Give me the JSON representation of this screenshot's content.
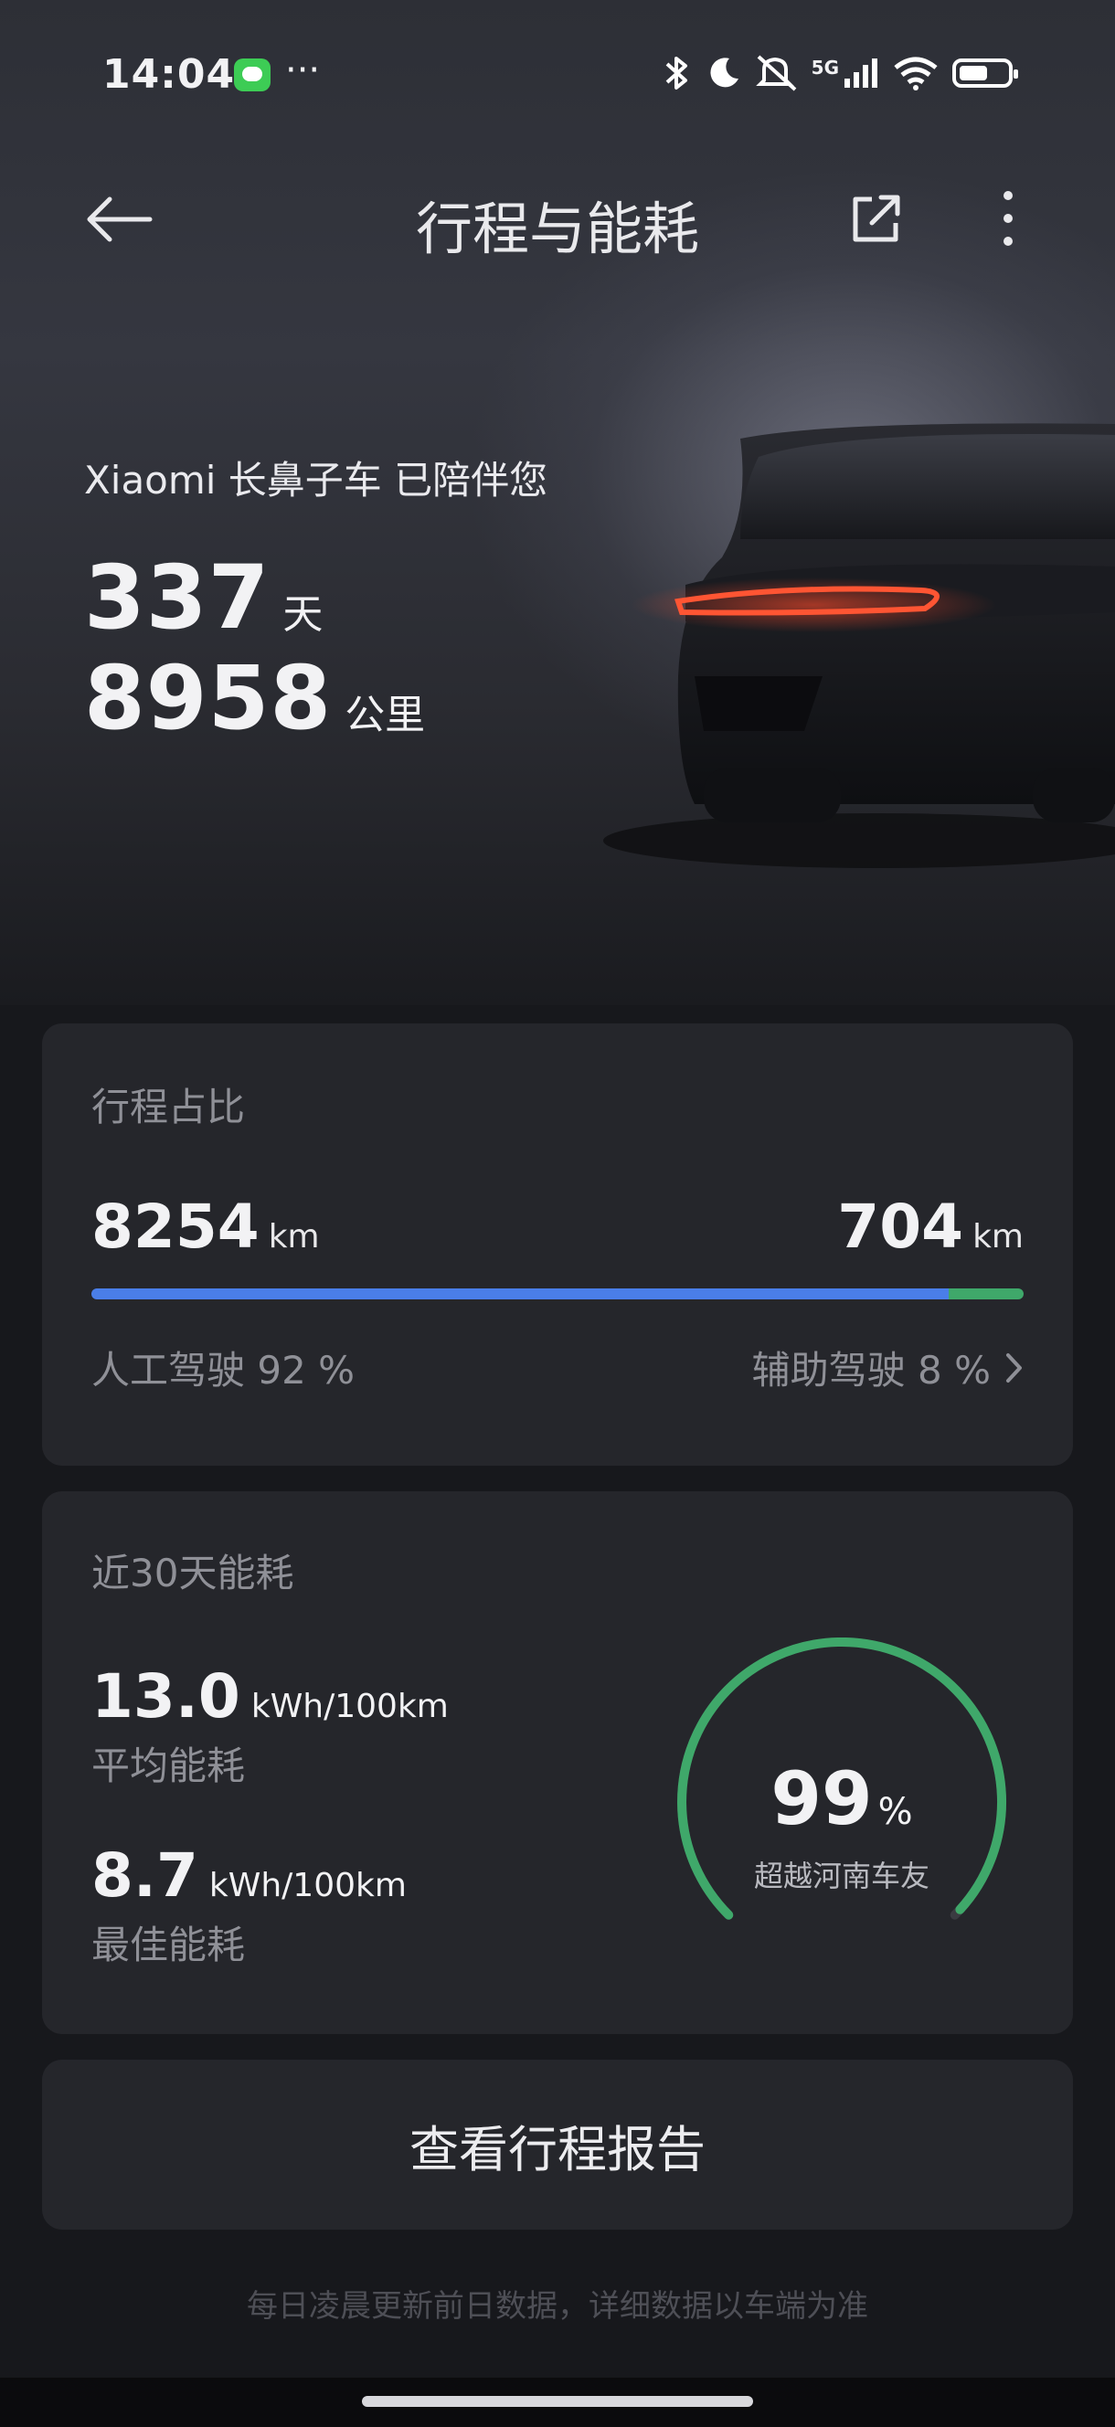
{
  "status_bar": {
    "time": "14:04",
    "dots": "···",
    "network": "5G"
  },
  "nav": {
    "title": "行程与能耗",
    "icons": [
      "back-arrow-icon",
      "share-icon",
      "more-icon"
    ]
  },
  "hero": {
    "intro": "Xiaomi 长鼻子车 已陪伴您",
    "days_value": "337",
    "days_unit": "天",
    "distance_value": "8958",
    "distance_unit": "公里"
  },
  "trip_card": {
    "title": "行程占比",
    "manual_km": "8254",
    "assisted_km": "704",
    "unit": "km",
    "manual_label": "人工驾驶 92 %",
    "assisted_label": "辅助驾驶 8 %",
    "manual_fraction": 0.92,
    "assisted_fraction": 0.08,
    "colors": {
      "manual": "#4a7ee8",
      "assisted": "#3fa86a"
    }
  },
  "energy_card": {
    "title": "近30天能耗",
    "avg_value": "13.0",
    "avg_unit": "kWh/100km",
    "avg_label": "平均能耗",
    "best_value": "8.7",
    "best_unit": "kWh/100km",
    "best_label": "最佳能耗",
    "gauge_value": "99",
    "gauge_unit": "%",
    "gauge_fraction": 0.99,
    "gauge_caption": "超越河南车友",
    "gauge_color": "#3fa86a"
  },
  "report_button": "查看行程报告",
  "footnote": "每日凌晨更新前日数据，详细数据以车端为准"
}
